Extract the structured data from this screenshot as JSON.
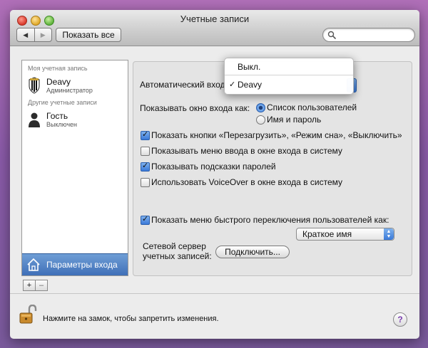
{
  "window": {
    "title": "Учетные записи"
  },
  "toolbar": {
    "back_glyph": "◀",
    "forward_glyph": "▶",
    "show_all_label": "Показать все",
    "search_value": ""
  },
  "sidebar": {
    "my_account_header": "Моя учетная запись",
    "other_accounts_header": "Другие учетные записи",
    "accounts": [
      {
        "name": "Deavy",
        "role": "Администратор",
        "icon": "avatar-icon"
      },
      {
        "name": "Гость",
        "role": "Выключен",
        "icon": "guest-user-icon"
      }
    ],
    "login_options_label": "Параметры входа",
    "add_label": "+",
    "remove_label": "–"
  },
  "panel": {
    "auto_login_label": "Автоматический вход",
    "show_login_as_label": "Показывать окно входа как:",
    "login_window_options": [
      {
        "label": "Список пользователей",
        "selected": true
      },
      {
        "label": "Имя и пароль",
        "selected": false
      }
    ],
    "checkboxes": [
      {
        "label": "Показать кнопки «Перезагрузить», «Режим сна», «Выключить»",
        "checked": true
      },
      {
        "label": "Показывать меню ввода в окне входа в систему",
        "checked": false
      },
      {
        "label": "Показывать подсказки паролей",
        "checked": true
      },
      {
        "label": "Использовать VoiceOver в окне входа в систему",
        "checked": false
      }
    ],
    "fast_switch": {
      "label": "Показать меню быстрого переключения пользователей как:",
      "checked": true
    },
    "fast_switch_value": "Краткое имя",
    "network_server_line1": "Сетевой сервер",
    "network_server_line2": "учетных записей:",
    "join_button_label": "Подключить..."
  },
  "auto_login_menu": {
    "items": [
      "Выкл.",
      "Deavy"
    ],
    "selected": "Deavy",
    "check_glyph": "✓"
  },
  "footer": {
    "lock_text": "Нажмите на замок, чтобы запретить изменения.",
    "help_label": "?"
  }
}
